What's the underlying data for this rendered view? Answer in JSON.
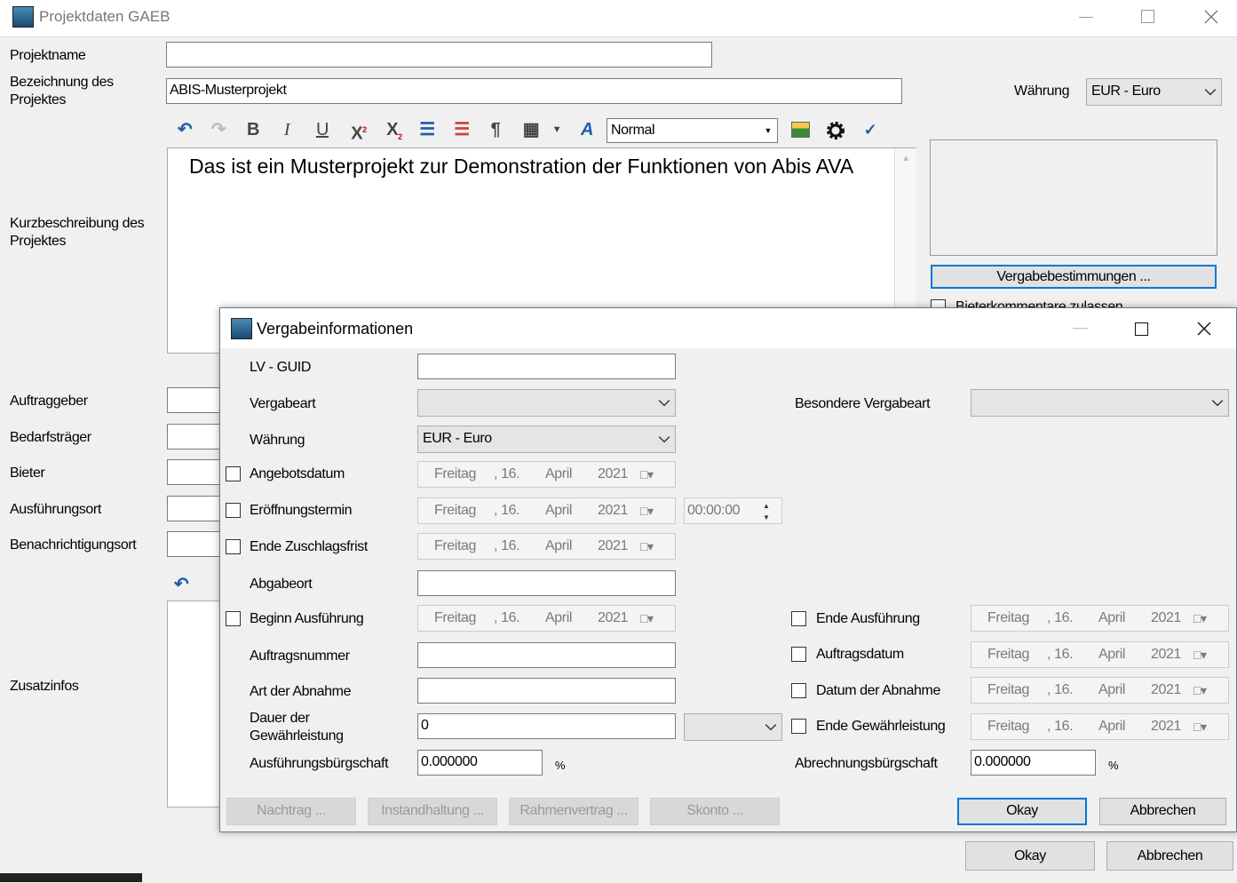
{
  "main_window": {
    "title": "Projektdaten GAEB",
    "labels": {
      "projektname": "Projektname",
      "bezeichnung": "Bezeichnung des Projektes",
      "kurzbeschreibung": "Kurzbeschreibung des Projektes",
      "auftraggeber": "Auftraggeber",
      "bedarfstraeger": "Bedarfsträger",
      "bieter": "Bieter",
      "ausfuehrungsort": "Ausführungsort",
      "benachrichtigungsort": "Benachrichtigungsort",
      "zusatzinfos": "Zusatzinfos",
      "waehrung": "Währung"
    },
    "projektname_value": "",
    "bezeichnung_value": "ABIS-Musterprojekt",
    "waehrung_value": "EUR - Euro",
    "style_combo_value": "Normal",
    "editor_text": "Das ist ein Musterprojekt zur Demonstration der Funktionen von Abis AVA",
    "vergabebestimmungen_button": "Vergabebestimmungen ...",
    "checkbox_partial": "Bieterkommentare zulassen",
    "okay_button": "Okay",
    "abbrechen_button": "Abbrechen"
  },
  "dialog": {
    "title": "Vergabeinformationen",
    "lv_guid_label": "LV - GUID",
    "lv_guid_value": "",
    "vergabeart_label": "Vergabeart",
    "besondere_vergabeart_label": "Besondere Vergabeart",
    "waehrung_label": "Währung",
    "waehrung_value": "EUR - Euro",
    "angebotsdatum_label": "Angebotsdatum",
    "eroeffnungstermin_label": "Eröffnungstermin",
    "time_value": "00:00:00",
    "ende_zuschlagsfrist_label": "Ende Zuschlagsfrist",
    "abgabeort_label": "Abgabeort",
    "beginn_ausfuehrung_label": "Beginn Ausführung",
    "ende_ausfuehrung_label": "Ende Ausführung",
    "auftragsnummer_label": "Auftragsnummer",
    "auftragsdatum_label": "Auftragsdatum",
    "art_abnahme_label": "Art der Abnahme",
    "datum_abnahme_label": "Datum der Abnahme",
    "dauer_label_1": "Dauer der",
    "dauer_label_2": "Gewährleistung",
    "dauer_value": "0",
    "ende_gewaehrleistung_label": "Ende Gewährleistung",
    "ausfuehrungsbuergschaft_label": "Ausführungsbürgschaft",
    "ausfuehrungsbuergschaft_value": "0.000000",
    "abrechnungsbuergschaft_label": "Abrechnungsbürgschaft",
    "abrechnungsbuergschaft_value": "0.000000",
    "percent": "%",
    "date_parts": {
      "weekday": "Freitag",
      "day": ", 16.",
      "month": "April",
      "year": "2021"
    },
    "buttons": {
      "nachtrag": "Nachtrag ...",
      "instandhaltung": "Instandhaltung ...",
      "rahmenvertrag": "Rahmenvertrag ...",
      "skonto": "Skonto ...",
      "okay": "Okay",
      "abbrechen": "Abbrechen"
    }
  }
}
